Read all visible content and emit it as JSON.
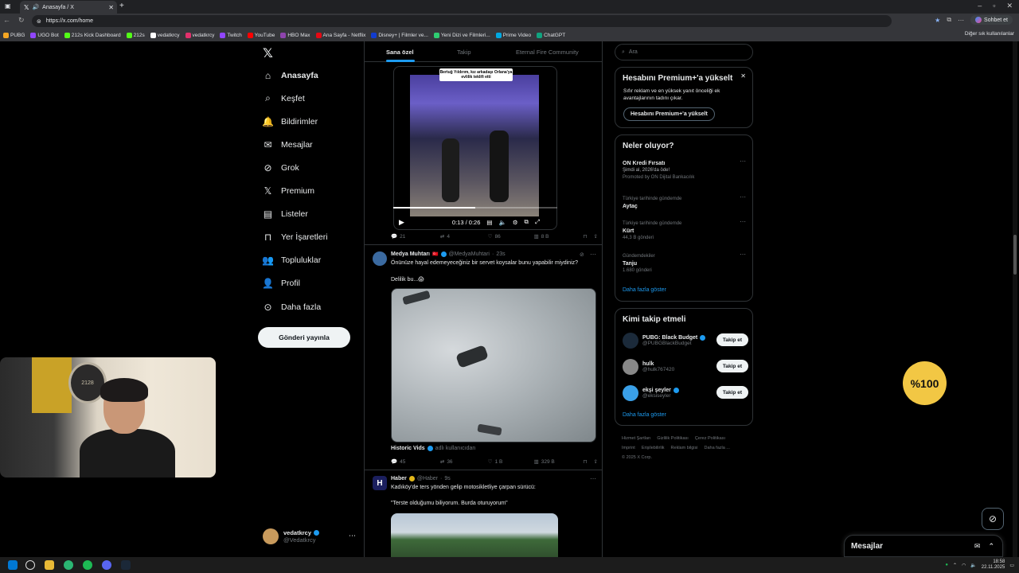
{
  "browser": {
    "tab_title": "Anasayfa / X",
    "url": "https://x.com/home",
    "sohbet_label": "Sohbet et",
    "bookmarks": [
      "PUBG",
      "UGO Bot",
      "212s Kick Dashboard",
      "212s",
      "vedatkrcy",
      "vedatkrcy",
      "Twitch",
      "YouTube",
      "HBO Max",
      "Ana Sayfa - Netflix",
      "Disney+ | Filmler ve...",
      "Yeni Dizi ve Filmleri...",
      "Prime Video",
      "ChatGPT"
    ],
    "other_bookmarks": "Diğer sık kullanılanlar"
  },
  "nav": {
    "items": [
      "Anasayfa",
      "Keşfet",
      "Bildirimler",
      "Mesajlar",
      "Grok",
      "Premium",
      "Listeler",
      "Yer İşaretleri",
      "Topluluklar",
      "Profil",
      "Daha fazla"
    ],
    "post_button": "Gönderi yayınla",
    "profile_name": "vedatkrcy",
    "profile_handle": "@Vedatkrcy"
  },
  "feed": {
    "tabs": [
      "Sana özel",
      "Takip",
      "Eternal Fire Community"
    ],
    "tweet1": {
      "video_caption": "Bertuğ Yıldırım, kız arkadaşı Orlana'ya evlilik teklifi etti",
      "time": "0:13 / 0:26",
      "progress": 0.5,
      "replies": "21",
      "retweets": "4",
      "likes": "86",
      "views": "8 B"
    },
    "tweet2": {
      "name": "Medya Muhtarı",
      "handle": "@MedyaMuhtari",
      "time": "23s",
      "text1": "Önünüze hayal edemeyeceğiniz bir servet koysalar bunu yapabilir miydiniz?",
      "text2": "Delilik bu...😱",
      "source_name": "Historic Vids",
      "source_handle": "adlı kullanıcıdan",
      "replies": "45",
      "retweets": "36",
      "likes": "1 B",
      "views": "329 B"
    },
    "tweet3": {
      "name": "Haber",
      "handle": "@Haber",
      "time": "9s",
      "text1": "Kadıköy'de ters yönden gelip motosikletliye çarpan sürücü:",
      "text2": "\"Terste olduğumu biliyorum. Burda oturuyorum\""
    }
  },
  "sidebar": {
    "search_placeholder": "Ara",
    "premium": {
      "title": "Hesabını Premium+'a yükselt",
      "desc1": "Sıfır reklam ve en yüksek yanıt önceliği ek",
      "desc2": "avantajlarının tadını çıkar.",
      "button": "Hesabını Premium+'a yükselt"
    },
    "trends_title": "Neler oluyor?",
    "trends": [
      {
        "title": "ON Kredi Fırsatı",
        "sub1": "Şimdi al, 2026'da öde!",
        "sub2": "Promoted by ON Dijital Bankacılık"
      },
      {
        "title": "Aytaç",
        "sub1": "Türkiye tarihinde gündemde",
        "sub2": ""
      },
      {
        "title": "Kürt",
        "sub1": "Türkiye tarihinde gündemde",
        "sub2": "44,3 B gönderi"
      },
      {
        "title": "Tanju",
        "sub1": "Gündemdekiler",
        "sub2": "1.680 gönderi"
      }
    ],
    "trends_more": "Daha fazla göster",
    "who_title": "Kimi takip etmeli",
    "who": [
      {
        "name": "PUBG: Black Budget",
        "handle": "@PUBGBlackBudget",
        "color": "#1b2a3a"
      },
      {
        "name": "hulk",
        "handle": "@hulk767420",
        "color": "#888"
      },
      {
        "name": "ekşi şeyler",
        "handle": "@eksiseyler",
        "color": "#3aa0e8"
      }
    ],
    "follow_label": "Takip et",
    "who_more": "Daha fazla göster",
    "footer": [
      "Hizmet Şartları",
      "Gizlilik Politikası",
      "Çerez Politikası",
      "Imprint",
      "Erişilebilirlik",
      "Reklam bilgisi",
      "Daha fazla ...",
      "© 2025 X Corp."
    ]
  },
  "overlay": {
    "badge_text": "%100",
    "webcam_logo": "2128",
    "dm_title": "Mesajlar"
  },
  "taskbar": {
    "time": "18:58",
    "date": "22.11.2025"
  },
  "colors": {
    "accent": "#1d9bf0",
    "background": "#000000",
    "border": "#2f3336",
    "muted": "#71767b"
  }
}
